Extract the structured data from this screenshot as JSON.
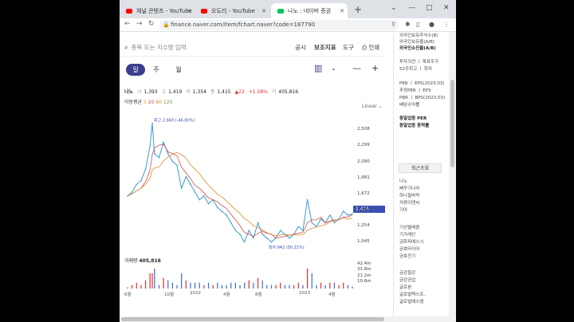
{
  "browser": {
    "tabs": [
      {
        "title": "채널 콘텐츠 - YouTube",
        "favicon_color": "#ff0000"
      },
      {
        "title": "오도리 - YouTube",
        "favicon_color": "#ff0000"
      },
      {
        "title": "나노 : 네이버 증권",
        "favicon_color": "#03c75a"
      }
    ],
    "url": "finance.naver.com/item/fchart.naver?code=187790",
    "new_tab": "+",
    "controls": [
      "⌄",
      "—",
      "□",
      "✕"
    ]
  },
  "page": {
    "search_placeholder": "종목 또는 지수명 입력",
    "menu": {
      "notice": "공시",
      "indicator": "보조지표",
      "tool": "도구",
      "print": "인쇄"
    },
    "periods": [
      "일",
      "주",
      "월"
    ],
    "stock": {
      "name": "나노",
      "open_label": "시",
      "open": "1,393",
      "high_label": "고",
      "high": "1,419",
      "low_label": "저",
      "low": "1,354",
      "close_label": "종",
      "close": "1,415",
      "change": "▲22",
      "change_pct": "+1.58%",
      "volume_label": "거",
      "volume": "405,816"
    },
    "ma": {
      "label": "이동평균",
      "values": [
        "5",
        "20",
        "60",
        "120"
      ],
      "colors": [
        "#e8a33c",
        "#d94b4b",
        "#e08a2e",
        "#7d8f3c"
      ]
    },
    "scale_mode": "Linear",
    "current_price_label": "1,415",
    "volume_title": "거래량",
    "volume_value": "405,816"
  },
  "chart_data": {
    "type": "line",
    "x_tick_labels": [
      "6월",
      "10월",
      "2022",
      "4월",
      "8월",
      "2023",
      "4월"
    ],
    "y_tick_labels": [
      "2,508",
      "2,299",
      "2,090",
      "1,881",
      "1,672",
      "1,463",
      "1,254",
      "1,045"
    ],
    "ylim": [
      900,
      2750
    ],
    "series": [
      {
        "name": "종가",
        "color": "#3a9bd5",
        "x_index": [
          0,
          2,
          4,
          6,
          8,
          10,
          11,
          12,
          14,
          16,
          18,
          20,
          22,
          24,
          26,
          28,
          30,
          32,
          34,
          36,
          38,
          40,
          42,
          44,
          46,
          48,
          50,
          52,
          54,
          56,
          58,
          60,
          62,
          64,
          66,
          68,
          70,
          72,
          74,
          76,
          78,
          80,
          82,
          84,
          86,
          88,
          90,
          92,
          94,
          96,
          98,
          100
        ],
        "values": [
          1650,
          1700,
          1800,
          1850,
          2000,
          2300,
          2600,
          2200,
          2150,
          2350,
          2200,
          2100,
          2050,
          1750,
          1900,
          1800,
          1700,
          1600,
          1650,
          1550,
          1600,
          1500,
          1450,
          1400,
          1300,
          1200,
          1150,
          1050,
          1200,
          1100,
          1300,
          1150,
          1100,
          1050,
          1100,
          1200,
          1150,
          1100,
          1150,
          1250,
          1200,
          1600,
          1300,
          1250,
          1350,
          1300,
          1400,
          1300,
          1350,
          1450,
          1400,
          1415
        ]
      }
    ],
    "annotations": [
      {
        "text": "최고 2,660 (-46.80%)",
        "x_index": 11,
        "y": 2660
      },
      {
        "text": "최저 942 (50.21%)",
        "x_index": 62,
        "y": 942
      }
    ],
    "volume_ticks": [
      "42.4m",
      "31.8m",
      "21.2m",
      "10.6m"
    ],
    "volume_ylim": [
      0,
      45
    ]
  },
  "right_panel": {
    "lines_top": [
      "외국인보유주식수(B)",
      "외국인보유율(A/B)",
      "외국인소진율(A/B)"
    ],
    "lines_mid": [
      "투자의견 ㅣ 목표주가",
      "52주최고 ㅣ 최저"
    ],
    "lines_per": [
      "PER ㅣ EPS(2023.03)",
      "추정PER ㅣ EPS",
      "PBR ㅣ BPS(2023.03)",
      "배당수익률"
    ],
    "lines_sector": [
      "동일업종 PER",
      "동일업종 등락률"
    ],
    "recent_title": "최근조회",
    "recent_items": [
      "나노",
      "뻐꾸기나라",
      "하나필바락",
      "카류이앤씨",
      "기아"
    ],
    "recent_items2": [
      "기산텔레콤",
      "기가레인",
      "금화피에스시",
      "금호타이어",
      "금호전기"
    ],
    "recent_items3": [
      "금강철강",
      "금강공업",
      "글로본",
      "글로벌텍스프..",
      "글로벌에스엠"
    ]
  }
}
